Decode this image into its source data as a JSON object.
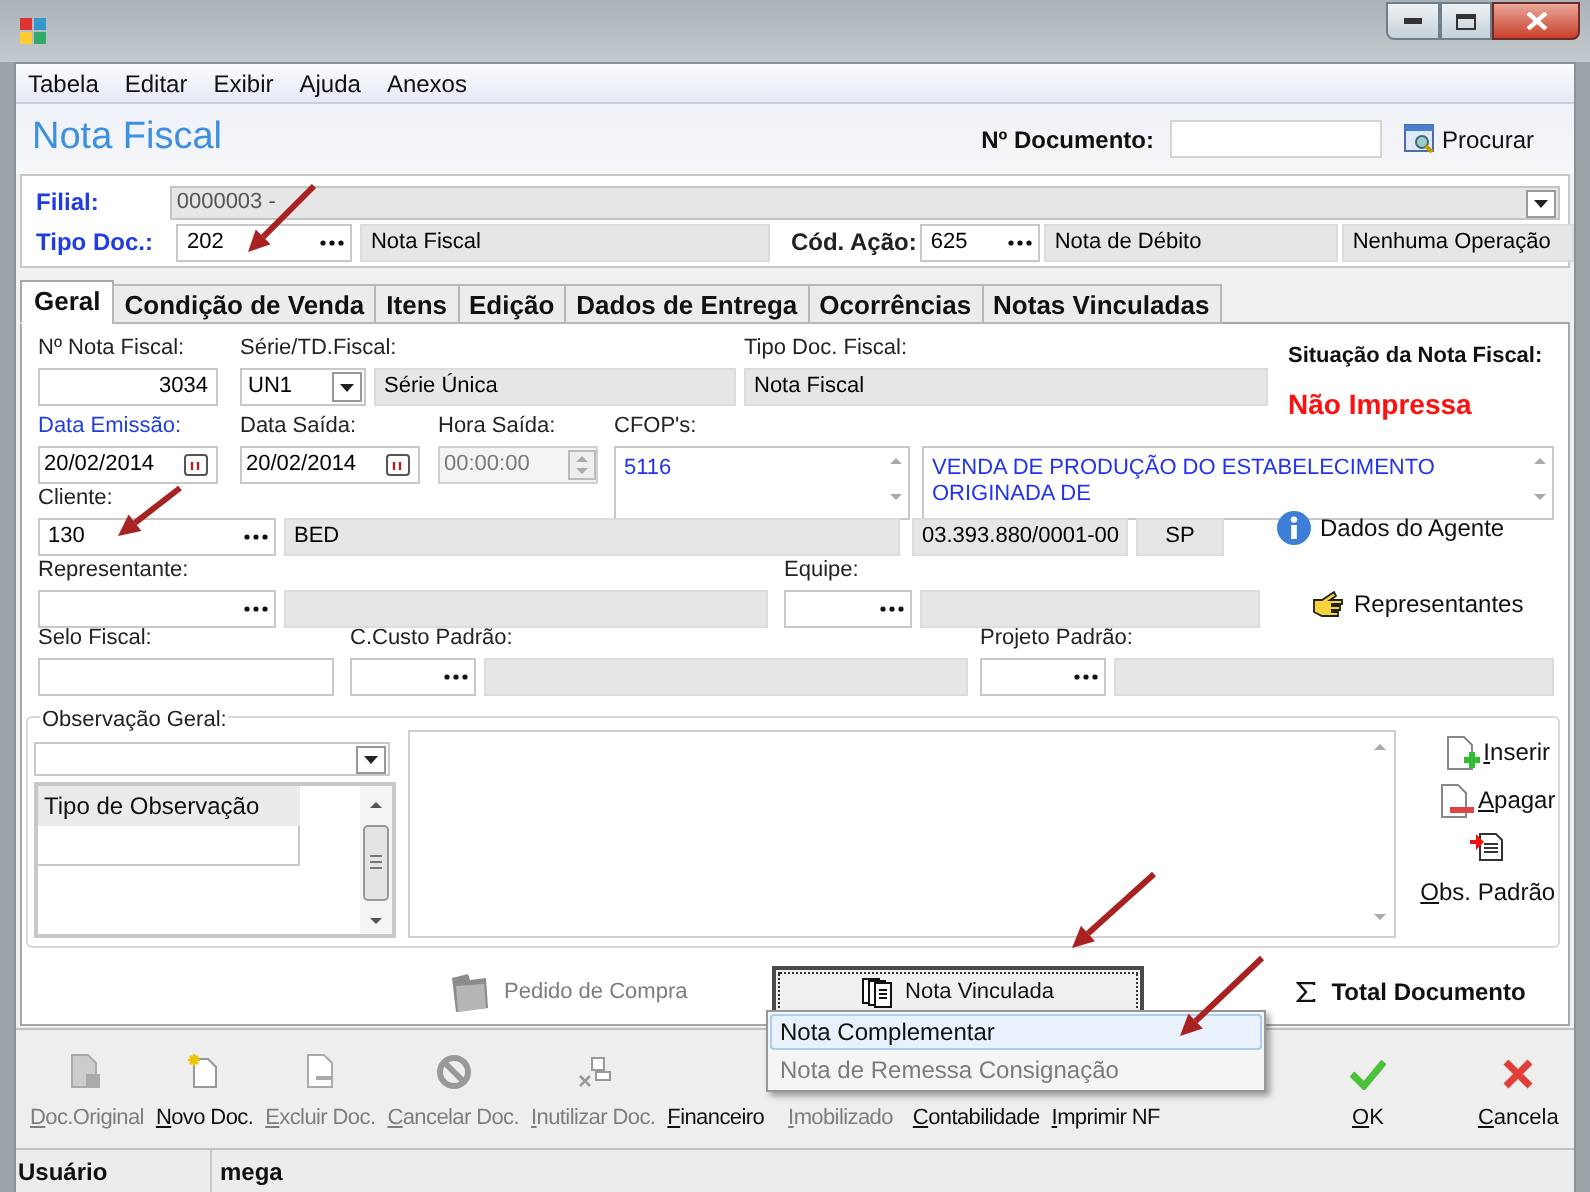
{
  "menu": [
    "Tabela",
    "Editar",
    "Exibir",
    "Ajuda",
    "Anexos"
  ],
  "header": {
    "title": "Nota Fiscal",
    "doc_label": "Nº Documento:",
    "search_button": "Procurar"
  },
  "filial": {
    "label": "Filial:",
    "value": "0000003 -",
    "required": true
  },
  "tipo_doc": {
    "label": "Tipo Doc.:",
    "code": "202",
    "name": "Nota Fiscal",
    "required": true
  },
  "cod_acao": {
    "label": "Cód. Ação:",
    "code": "625",
    "name": "Nota de Débito",
    "operation": "Nenhuma Operação"
  },
  "tabs": [
    {
      "label": "Geral",
      "selected": true
    },
    {
      "label": "Condição de Venda",
      "selected": false
    },
    {
      "label": "Itens",
      "selected": false
    },
    {
      "label": "Edição",
      "selected": false
    },
    {
      "label": "Dados de Entrega",
      "selected": false
    },
    {
      "label": "Ocorrências",
      "selected": false
    },
    {
      "label": "Notas Vinculadas",
      "selected": false
    }
  ],
  "geral": {
    "nota_numero": {
      "label": "Nº Nota Fiscal:",
      "value": "3034"
    },
    "serie": {
      "label": "Série/TD.Fiscal:",
      "code": "UN1",
      "name": "Série Única"
    },
    "tipo_doc_fiscal": {
      "label": "Tipo Doc. Fiscal:",
      "value": "Nota Fiscal"
    },
    "situacao": {
      "label": "Situação da Nota Fiscal:",
      "value": "Não Impressa"
    },
    "data_emissao": {
      "label": "Data Emissão:",
      "value": "20/02/2014",
      "required": true
    },
    "data_saida": {
      "label": "Data Saída:",
      "value": "20/02/2014",
      "required": false
    },
    "hora_saida": {
      "label": "Hora Saída:",
      "value": "00:00:00",
      "disabled": true
    },
    "cfop": {
      "label": "CFOP's:",
      "value": "5116",
      "description": "VENDA DE PRODUÇÃO DO ESTABELECIMENTO ORIGINADA DE"
    },
    "cliente": {
      "label": "Cliente:",
      "code": "130",
      "name": "BED",
      "cnpj": "03.393.880/0001-00",
      "uf": "SP"
    },
    "dados_agente": "Dados do Agente",
    "representante": {
      "label": "Representante:"
    },
    "equipe": {
      "label": "Equipe:"
    },
    "representantes": "Representantes",
    "selo_fiscal": {
      "label": "Selo Fiscal:"
    },
    "centro_custo": {
      "label": "C.Custo Padrão:"
    },
    "projeto": {
      "label": "Projeto Padrão:"
    }
  },
  "observacao": {
    "label": "Observação Geral:",
    "list_header": "Tipo de Observação",
    "actions": [
      "Inserir",
      "Apagar",
      "Obs. Padrão"
    ]
  },
  "pedido_compra": {
    "label": "Pedido de Compra",
    "disabled": true
  },
  "nota_vinculada": "Nota Vinculada",
  "total_documento": "Total Documento",
  "popup_menu": [
    {
      "label": "Nota Complementar",
      "selected": true,
      "disabled": false
    },
    {
      "label": "Nota de Remessa Consignação",
      "selected": false,
      "disabled": true
    }
  ],
  "toolbar": [
    {
      "label": "Doc.Original",
      "disabled": true
    },
    {
      "label": "Novo Doc.",
      "disabled": false
    },
    {
      "label": "Excluir Doc.",
      "disabled": true
    },
    {
      "label": "Cancelar Doc.",
      "disabled": true
    },
    {
      "label": "Inutilizar Doc.",
      "disabled": true
    },
    {
      "label": "Financeiro",
      "disabled": false
    },
    {
      "label": "Imobilizado",
      "disabled": true
    },
    {
      "label": "Contabilidade",
      "disabled": false
    },
    {
      "label": "Imprimir NF",
      "disabled": false
    }
  ],
  "dialog_buttons": [
    "OK",
    "Cancela"
  ],
  "status_bar": [
    "Usuário",
    "mega"
  ]
}
